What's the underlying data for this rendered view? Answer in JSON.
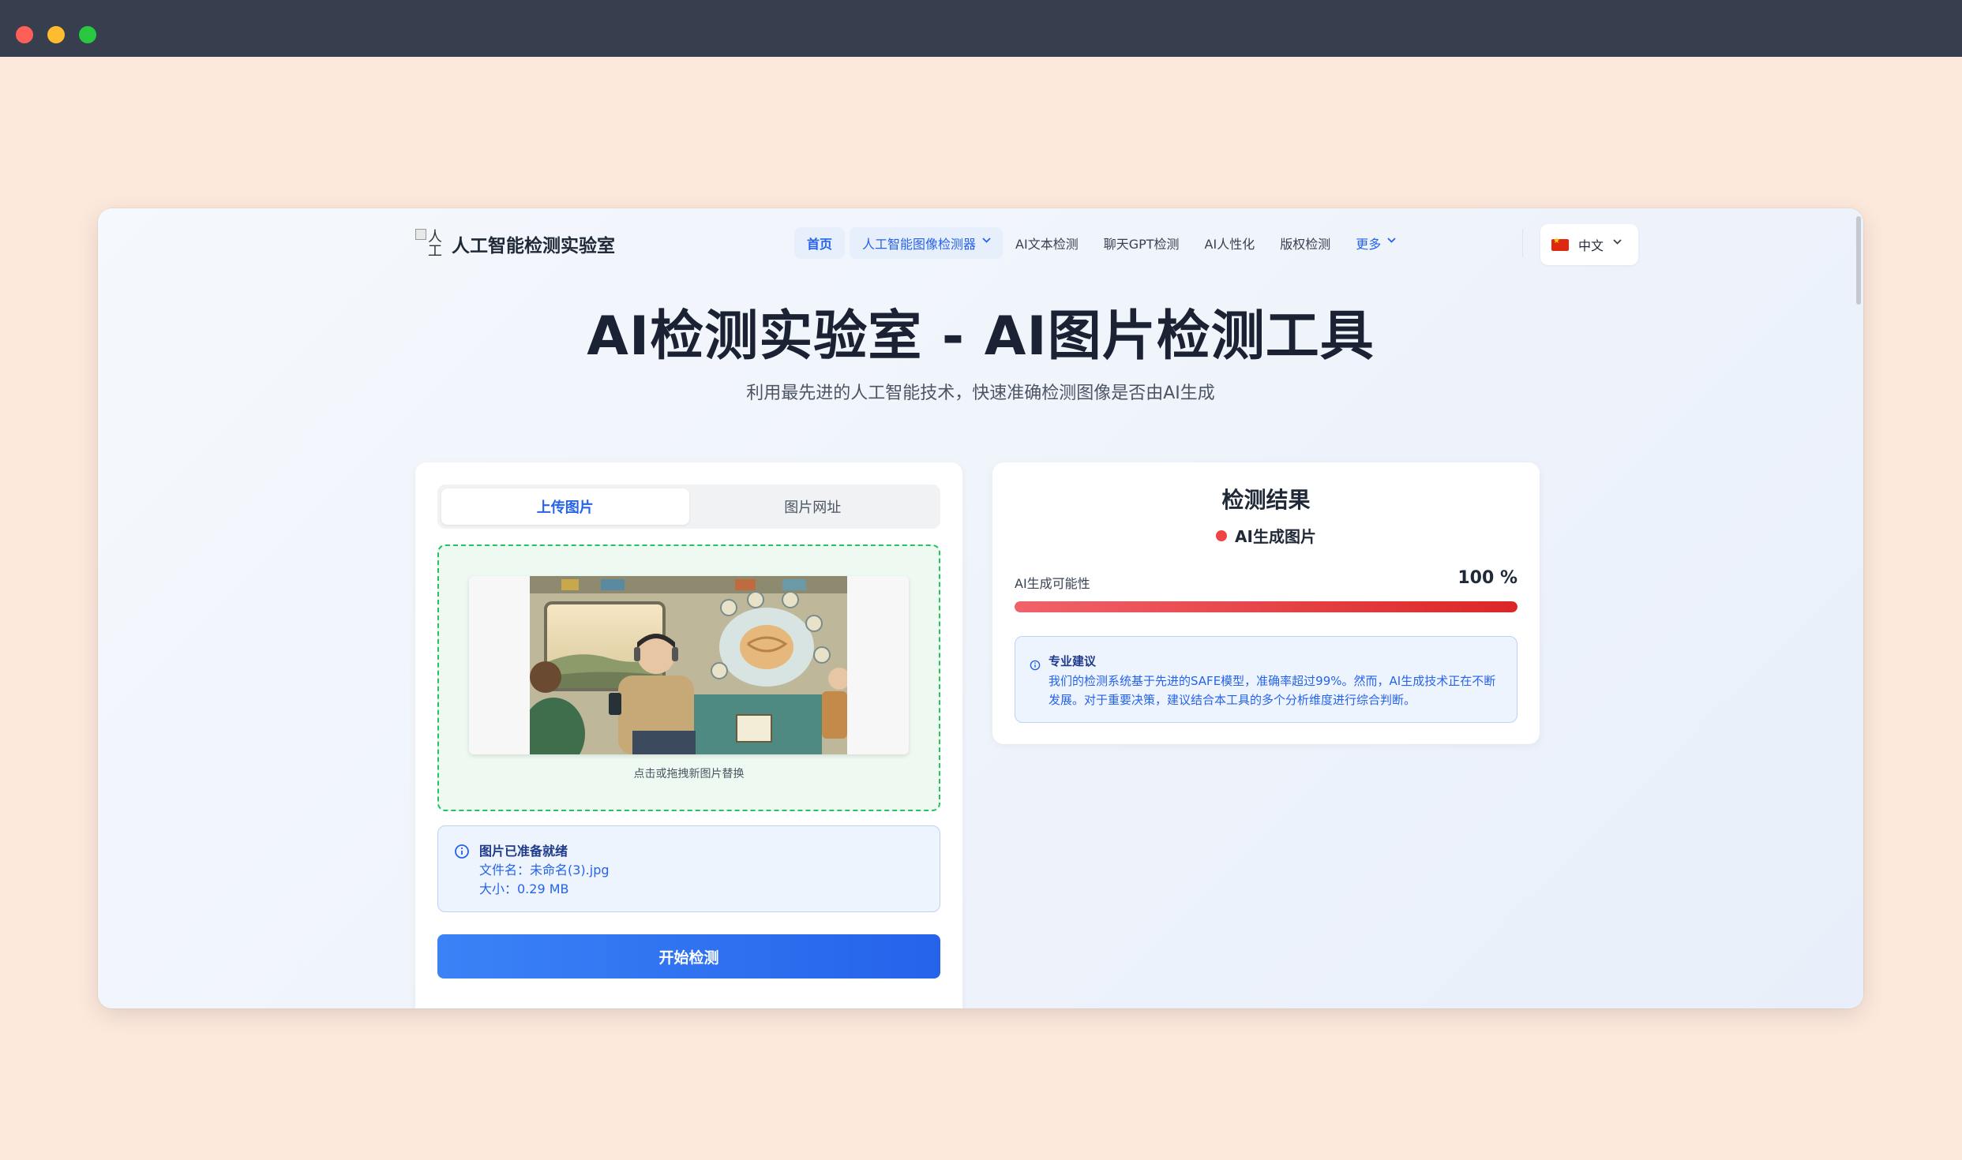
{
  "window_controls": {
    "close": "close",
    "minimize": "minimize",
    "maximize": "maximize"
  },
  "nav": {
    "logo_alt": "人工",
    "logo_text": "人工智能检测实验室",
    "links": [
      {
        "label": "首页",
        "active": true
      },
      {
        "label": "人工智能图像检测器",
        "dropdown": true
      },
      {
        "label": "AI文本检测"
      },
      {
        "label": "聊天GPT检测"
      },
      {
        "label": "AI人性化"
      },
      {
        "label": "版权检测"
      },
      {
        "label": "更多",
        "dropdown": true
      }
    ],
    "language": {
      "label": "中文",
      "flag": "cn-flag-icon"
    }
  },
  "hero": {
    "title": "AI检测实验室 - AI图片检测工具",
    "subtitle": "利用最先进的人工智能技术，快速准确检测图像是否由AI生成"
  },
  "upload_card": {
    "tabs": [
      "上传图片",
      "图片网址"
    ],
    "active_tab": 0,
    "dropzone_hint": "点击或拖拽新图片替换",
    "info": {
      "title": "图片已准备就绪",
      "filename_line": "文件名：未命名(3).jpg",
      "size_line": "大小：0.29 MB"
    },
    "start_button": "开始检测"
  },
  "result_card": {
    "title": "检测结果",
    "status": "AI生成图片",
    "status_color": "#ef4444",
    "probability_label": "AI生成可能性",
    "probability_text": "100 %",
    "probability_value": 1.0,
    "advice_title": "专业建议",
    "advice_text": "我们的检测系统基于先进的SAFE模型，准确率超过99%。然而，AI生成技术正在不断发展。对于重要决策，建议结合本工具的多个分析维度进行综合判断。"
  },
  "colors": {
    "accent": "#2563eb",
    "success_border": "#22c55e",
    "danger": "#dc2626",
    "page_background": "#fde9dc",
    "titlebar": "#373f4e"
  }
}
